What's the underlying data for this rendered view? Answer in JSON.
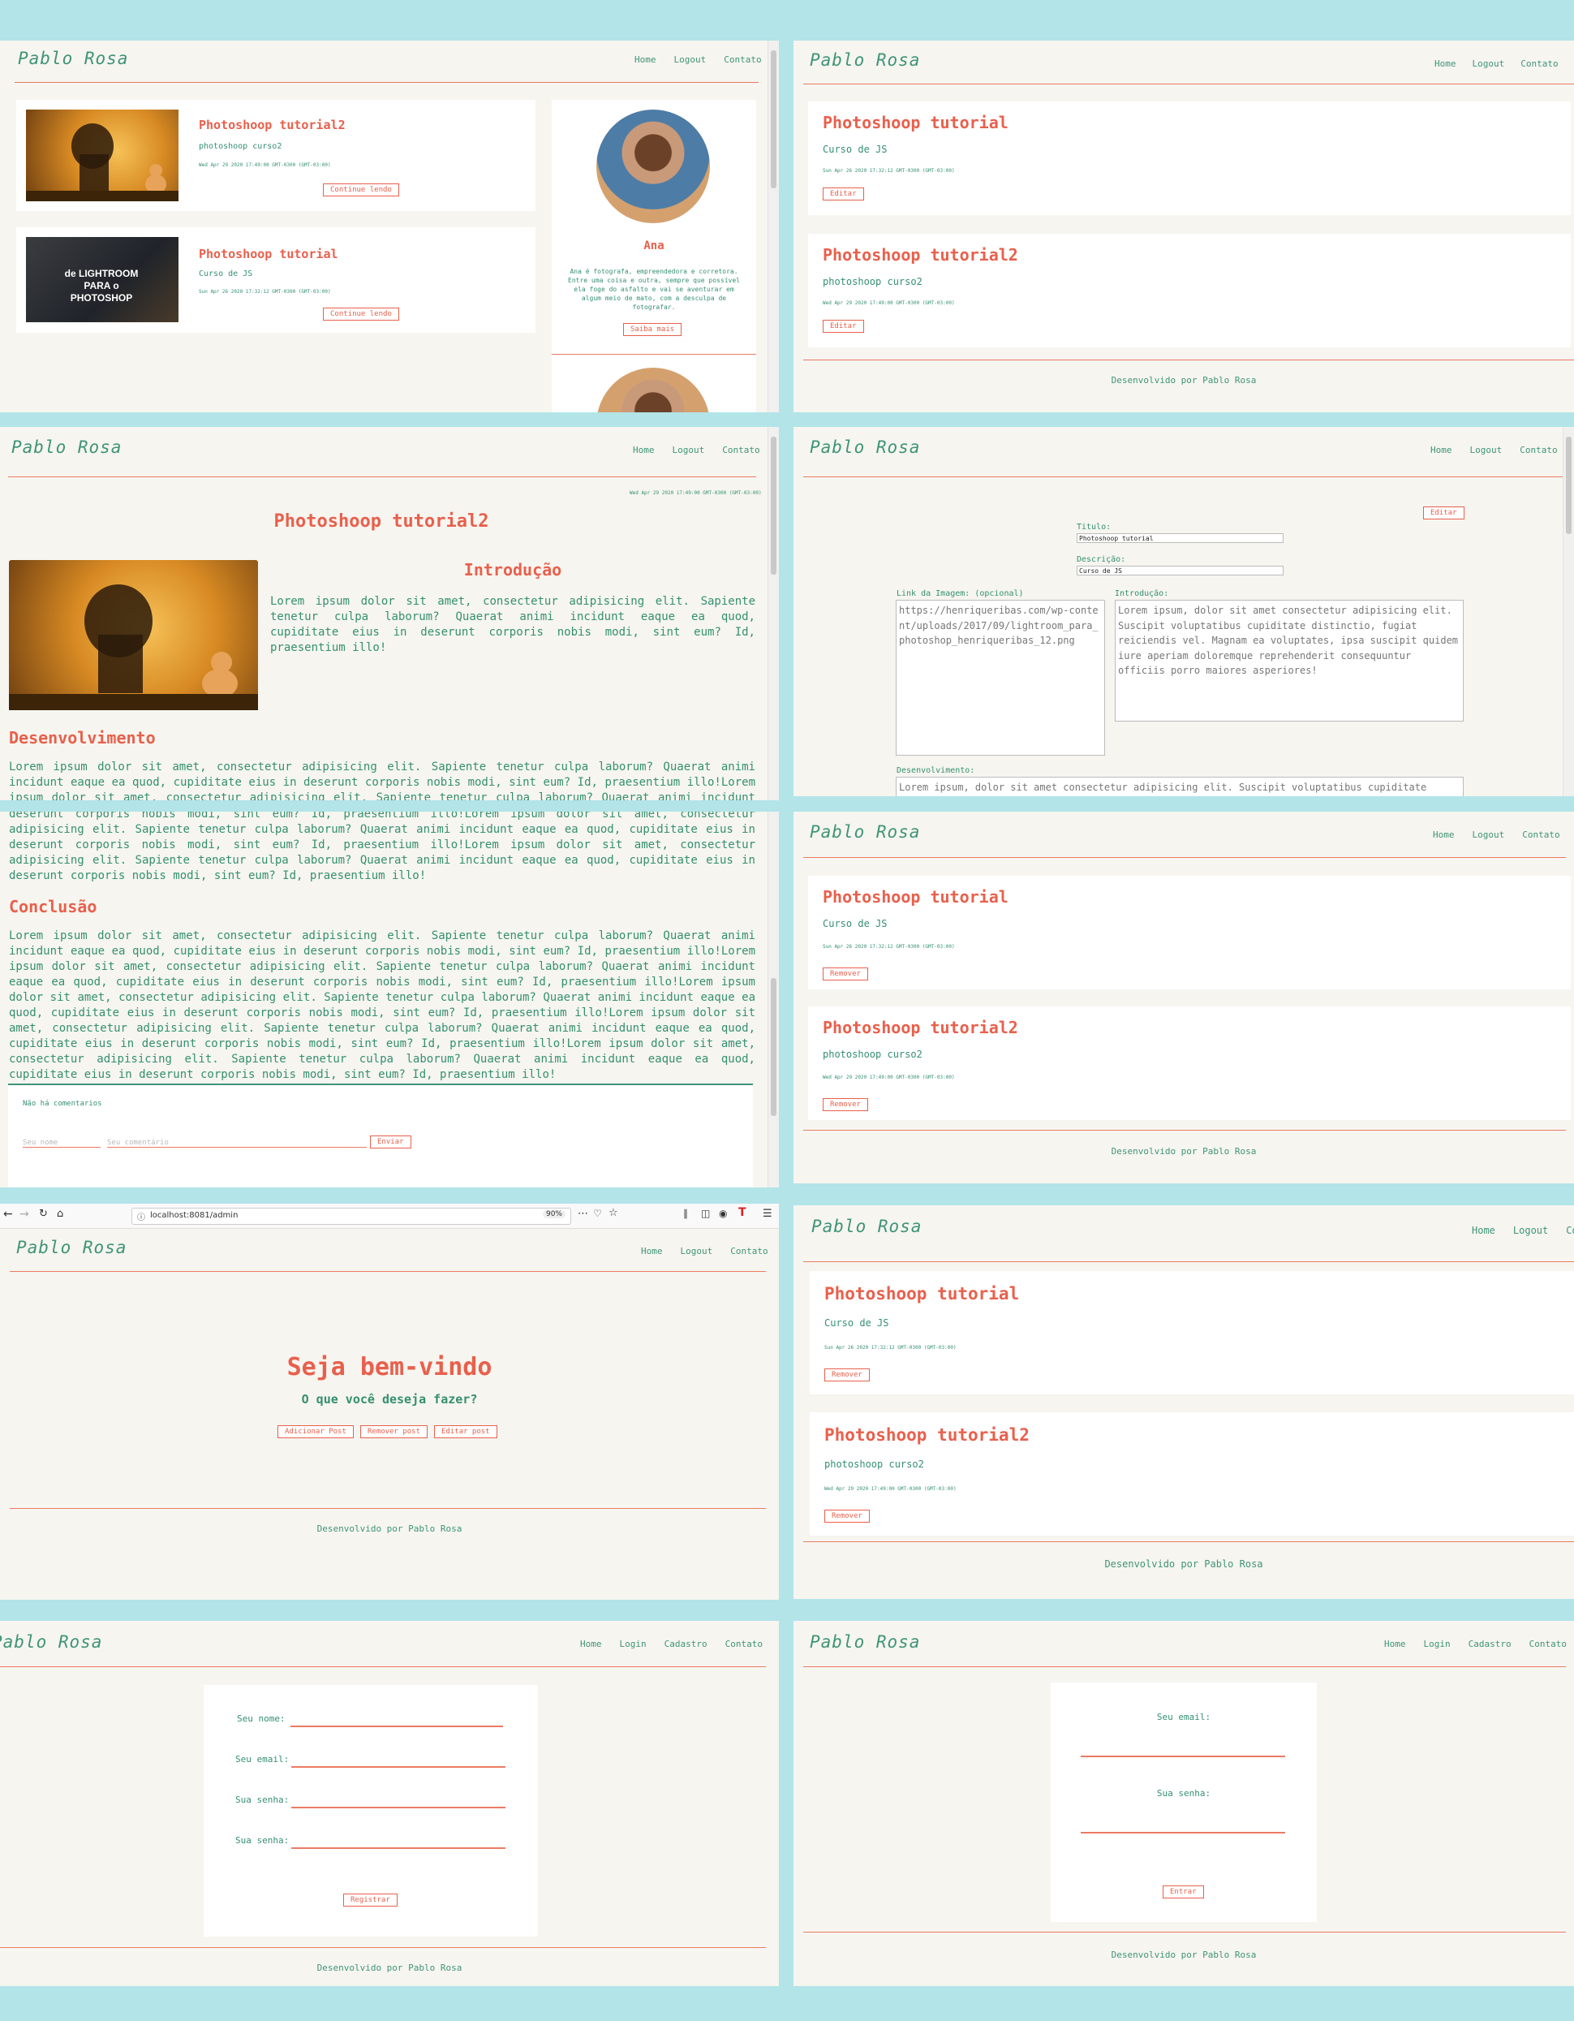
{
  "site": {
    "brand": "Pablo Rosa",
    "nav_home": "Home",
    "nav_logout": "Logout",
    "nav_contato": "Contato",
    "nav_login": "Login",
    "nav_cadastro": "Cadastro",
    "footer": "Desenvolvido por Pablo Rosa"
  },
  "home": {
    "posts": [
      {
        "title": "Photoshoop tutorial2",
        "desc": "photoshoop curso2",
        "date": "Wed Apr 29 2020 17:49:00 GMT-0300 (GMT-03:00)",
        "button": "Continue lendo",
        "image_text": ""
      },
      {
        "title": "Photoshoop tutorial",
        "desc": "Curso de JS",
        "date": "Sun Apr 26 2020 17:32:12 GMT-0300 (GMT-03:00)",
        "button": "Continue lendo",
        "image_text": "de LIGHTROOM PARA o PHOTOSHOP"
      }
    ],
    "sidebar": {
      "name": "Ana",
      "bio": "Ana é fotografa, empreendedora e corretora. Entre uma coisa e outra, sempre que possível ela foge do asfalto e vai se aventurar em algum meio de mato, com a desculpa de fotografar.",
      "button": "Saiba mais"
    }
  },
  "edit_list": {
    "posts": [
      {
        "title": "Photoshoop tutorial",
        "desc": "Curso de JS",
        "date": "Sun Apr 26 2020 17:32:12 GMT-0300 (GMT-03:00)",
        "button": "Editar"
      },
      {
        "title": "Photoshoop tutorial2",
        "desc": "photoshoop curso2",
        "date": "Wed Apr 29 2020 17:49:00 GMT-0300 (GMT-03:00)",
        "button": "Editar"
      }
    ]
  },
  "article": {
    "date": "Wed Apr 29 2020 17:49:00 GMT-0300 (GMT-03:00)",
    "title": "Photoshoop tutorial2",
    "intro_heading": "Introdução",
    "intro_text": "Lorem ipsum dolor sit amet, consectetur adipisicing elit. Sapiente tenetur culpa laborum? Quaerat animi incidunt eaque ea quod, cupiditate eius in deserunt corporis nobis modi, sint eum? Id, praesentium illo!",
    "dev_heading": "Desenvolvimento",
    "dev_text": "Lorem ipsum dolor sit amet, consectetur adipisicing elit. Sapiente tenetur culpa laborum? Quaerat animi incidunt eaque ea quod, cupiditate eius in deserunt corporis nobis modi, sint eum? Id, praesentium illo!Lorem ipsum dolor sit amet, consectetur adipisicing elit. Sapiente tenetur culpa laborum? Quaerat animi incidunt eaque ea quod, cupiditate eius in",
    "cont_text": "deserunt corporis nobis modi, sint eum? Id, praesentium illo!Lorem ipsum dolor sit amet, consectetur adipisicing elit. Sapiente tenetur culpa laborum? Quaerat animi incidunt eaque ea quod, cupiditate eius in deserunt corporis nobis modi, sint eum? Id, praesentium illo!Lorem ipsum dolor sit amet, consectetur adipisicing elit. Sapiente tenetur culpa laborum? Quaerat animi incidunt eaque ea quod, cupiditate eius in deserunt corporis nobis modi, sint eum? Id, praesentium illo!",
    "concl_heading": "Conclusão",
    "concl_text": "Lorem ipsum dolor sit amet, consectetur adipisicing elit. Sapiente tenetur culpa laborum? Quaerat animi incidunt eaque ea quod, cupiditate eius in deserunt corporis nobis modi, sint eum? Id, praesentium illo!Lorem ipsum dolor sit amet, consectetur adipisicing elit. Sapiente tenetur culpa laborum? Quaerat animi incidunt eaque ea quod, cupiditate eius in deserunt corporis nobis modi, sint eum? Id, praesentium illo!Lorem ipsum dolor sit amet, consectetur adipisicing elit. Sapiente tenetur culpa laborum? Quaerat animi incidunt eaque ea quod, cupiditate eius in deserunt corporis nobis modi, sint eum? Id, praesentium illo!Lorem ipsum dolor sit amet, consectetur adipisicing elit. Sapiente tenetur culpa laborum? Quaerat animi incidunt eaque ea quod, cupiditate eius in deserunt corporis nobis modi, sint eum? Id, praesentium illo!Lorem ipsum dolor sit amet, consectetur adipisicing elit. Sapiente tenetur culpa laborum? Quaerat animi incidunt eaque ea quod, cupiditate eius in deserunt corporis nobis modi, sint eum? Id, praesentium illo!",
    "no_comments": "Não há comentarios",
    "name_placeholder": "Seu nome",
    "comment_placeholder": "Seu comentário",
    "send_button": "Enviar"
  },
  "edit_form": {
    "edit_button": "Editar",
    "titulo_label": "Titulo:",
    "titulo_value": "Photoshoop tutorial",
    "descricao_label": "Descrição:",
    "descricao_value": "Curso de JS",
    "image_label": "Link da Imagem: (opcional)",
    "image_value": "https://henriqueribas.com/wp-content/uploads/2017/09/lightroom_para_photoshop_henriqueribas_12.png",
    "intro_label": "Introdução:",
    "intro_value": "Lorem ipsum, dolor sit amet consectetur adipisicing elit. Suscipit voluptatibus cupiditate distinctio, fugiat reiciendis vel. Magnam ea voluptates, ipsa suscipit quidem iure aperiam doloremque reprehenderit consequuntur officiis porro maiores asperiores!",
    "dev_label": "Desenvolvimento:",
    "dev_value": "Lorem ipsum, dolor sit amet consectetur adipisicing elit. Suscipit voluptatibus cupiditate"
  },
  "remove_list": {
    "posts": [
      {
        "title": "Photoshoop tutorial",
        "desc": "Curso de JS",
        "date": "Sun Apr 26 2020 17:32:12 GMT-0300 (GMT-03:00)",
        "button": "Remover"
      },
      {
        "title": "Photoshoop tutorial2",
        "desc": "photoshoop curso2",
        "date": "Wed Apr 29 2020 17:49:00 GMT-0300 (GMT-03:00)",
        "button": "Remover"
      }
    ]
  },
  "browser": {
    "url": "localhost:8081/admin",
    "zoom": "90%"
  },
  "admin": {
    "welcome": "Seja bem-vindo",
    "question": "O que você deseja fazer?",
    "add_button": "Adicionar Post",
    "remove_button": "Remover post",
    "edit_button": "Editar post"
  },
  "register": {
    "name_label": "Seu nome:",
    "email_label": "Seu email:",
    "password_label": "Sua senha:",
    "password2_label": "Sua senha:",
    "button": "Registrar"
  },
  "login": {
    "email_label": "Seu email:",
    "password_label": "Sua senha:",
    "button": "Entrar"
  }
}
